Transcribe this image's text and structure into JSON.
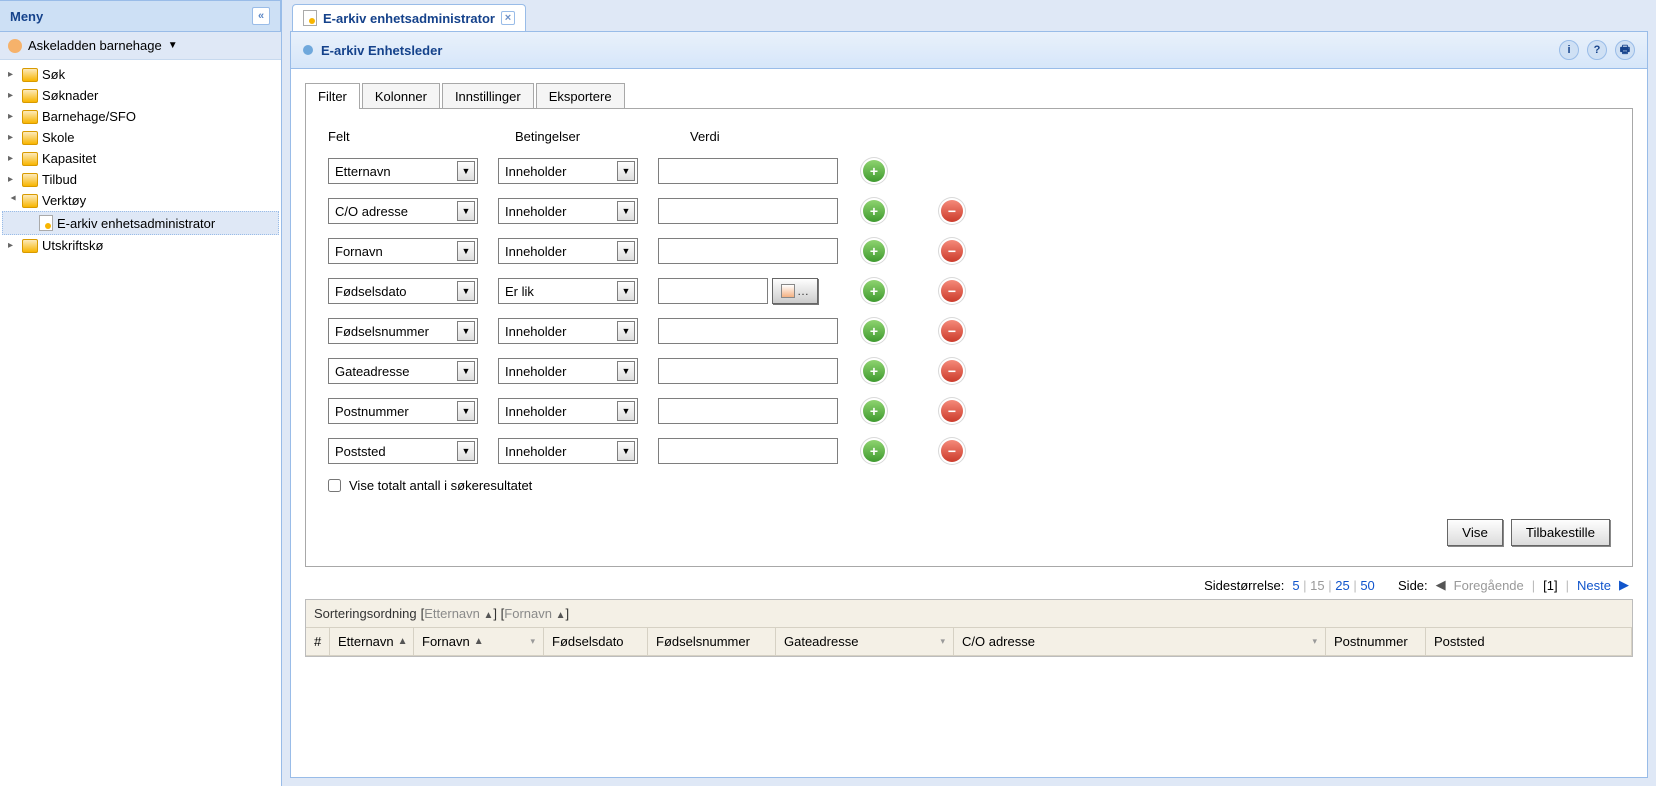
{
  "sidebar": {
    "title": "Meny",
    "org": "Askeladden barnehage",
    "items": [
      {
        "label": "Søk"
      },
      {
        "label": "Søknader"
      },
      {
        "label": "Barnehage/SFO"
      },
      {
        "label": "Skole"
      },
      {
        "label": "Kapasitet"
      },
      {
        "label": "Tilbud"
      },
      {
        "label": "Verktøy",
        "expanded": true,
        "children": [
          {
            "label": "E-arkiv enhetsadministrator",
            "selected": true
          }
        ]
      },
      {
        "label": "Utskriftskø"
      }
    ]
  },
  "tab": {
    "label": "E-arkiv enhetsadministrator"
  },
  "panel": {
    "title": "E-arkiv Enhetsleder"
  },
  "inner_tabs": [
    "Filter",
    "Kolonner",
    "Innstillinger",
    "Eksportere"
  ],
  "filter": {
    "head": {
      "felt": "Felt",
      "bet": "Betingelser",
      "verdi": "Verdi"
    },
    "rows": [
      {
        "felt": "Etternavn",
        "bet": "Inneholder",
        "type": "text",
        "rem": false
      },
      {
        "felt": "C/O adresse",
        "bet": "Inneholder",
        "type": "text",
        "rem": true
      },
      {
        "felt": "Fornavn",
        "bet": "Inneholder",
        "type": "text",
        "rem": true
      },
      {
        "felt": "Fødselsdato",
        "bet": "Er lik",
        "type": "date",
        "rem": true
      },
      {
        "felt": "Fødselsnummer",
        "bet": "Inneholder",
        "type": "text",
        "rem": true
      },
      {
        "felt": "Gateadresse",
        "bet": "Inneholder",
        "type": "text",
        "rem": true
      },
      {
        "felt": "Postnummer",
        "bet": "Inneholder",
        "type": "text",
        "rem": true
      },
      {
        "felt": "Poststed",
        "bet": "Inneholder",
        "type": "text",
        "rem": true
      }
    ],
    "checkbox": "Vise totalt antall i søkeresultatet",
    "btn_vise": "Vise",
    "btn_reset": "Tilbakestille"
  },
  "pager": {
    "size_label": "Sidestørrelse:",
    "sizes": [
      "5",
      "15",
      "25",
      "50"
    ],
    "side_label": "Side:",
    "prev": "Foregående",
    "current": "[1]",
    "next": "Neste"
  },
  "grid": {
    "sort_label": "Sorteringsordning",
    "sort_cols": [
      "Etternavn",
      "Fornavn"
    ],
    "headers": [
      "#",
      "Etternavn",
      "Fornavn",
      "Fødselsdato",
      "Fødselsnummer",
      "Gateadresse",
      "C/O adresse",
      "Postnummer",
      "Poststed"
    ]
  }
}
